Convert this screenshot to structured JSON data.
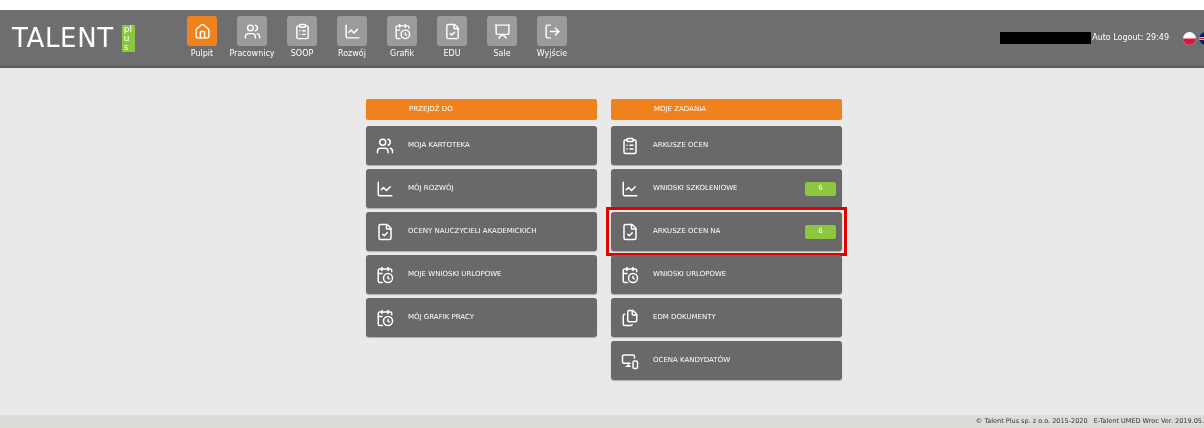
{
  "header": {
    "logo": {
      "word": "TALENT",
      "badge": "plus"
    },
    "nav": [
      {
        "label": "Pulpit",
        "kind": "home",
        "selected": true
      },
      {
        "label": "Pracownicy",
        "kind": "users",
        "selected": false
      },
      {
        "label": "SOOP",
        "kind": "list",
        "selected": false
      },
      {
        "label": "Rozwój",
        "kind": "chart",
        "selected": false
      },
      {
        "label": "Grafik",
        "kind": "calendar",
        "selected": false
      },
      {
        "label": "EDU",
        "kind": "doccheck",
        "selected": false
      },
      {
        "label": "Sale",
        "kind": "room",
        "selected": false
      },
      {
        "label": "Wyjście",
        "kind": "exit",
        "selected": false
      }
    ],
    "auto_logout": "Auto Logout: 29:49"
  },
  "panels": [
    {
      "title": "PRZEJDŹ DO",
      "items": [
        {
          "label": "MOJA KARTOTEKA",
          "kind": "users",
          "highlighted": false
        },
        {
          "label": "MÓJ ROZWÓJ",
          "kind": "chart",
          "highlighted": false
        },
        {
          "label": "OCENY NAUCZYCIELI AKADEMICKICH",
          "kind": "doccheck",
          "highlighted": false
        },
        {
          "label": "MOJE WNIOSKI URLOPOWE",
          "kind": "calendar",
          "highlighted": false
        },
        {
          "label": "MÓJ GRAFIK PRACY",
          "kind": "calendar",
          "highlighted": false
        }
      ]
    },
    {
      "title": "MOJE ZADANIA",
      "items": [
        {
          "label": "ARKUSZE OCEN",
          "kind": "list",
          "highlighted": false
        },
        {
          "label": "WNIOSKI SZKOLENIOWE",
          "kind": "chart",
          "count": "6",
          "highlighted": false
        },
        {
          "label": "ARKUSZE OCEN NA",
          "kind": "doccheck",
          "count": "6",
          "highlighted": true
        },
        {
          "label": "WNIOSKI URLOPOWE",
          "kind": "calendar",
          "highlighted": false
        },
        {
          "label": "EDM DOKUMENTY",
          "kind": "docs",
          "highlighted": false
        },
        {
          "label": "OCENA KANDYDATÓW",
          "kind": "monitor",
          "highlighted": false
        }
      ]
    }
  ],
  "footer": "© Talent Plus sp. z o.o. 2015-2020   E-Talent UMED Wroc Ver. 2019.05."
}
